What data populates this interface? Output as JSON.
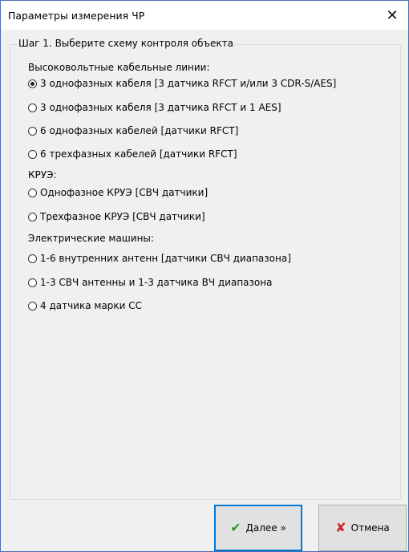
{
  "window": {
    "title": "Параметры измерения ЧР",
    "close_symbol": "✕"
  },
  "group": {
    "legend": "Шаг 1. Выберите схему контроля объекта"
  },
  "sections": {
    "hv_cables": "Высоковольтные кабельные линии:",
    "kru": "КРУЭ:",
    "machines": "Электрические машины:"
  },
  "options": [
    {
      "label": "3 однофазных кабеля [3 датчика RFCT и/или 3 CDR-S/AES]",
      "checked": true
    },
    {
      "label": "3 однофазных кабеля [3 датчика RFCT и 1 AES]",
      "checked": false
    },
    {
      "label": "6 однофазных кабелей [датчики RFCT]",
      "checked": false
    },
    {
      "label": "6 трехфазных кабелей [датчики RFCT]",
      "checked": false
    },
    {
      "label": "Однофазное КРУЭ [СВЧ датчики]",
      "checked": false
    },
    {
      "label": "Трехфазное КРУЭ [СВЧ датчики]",
      "checked": false
    },
    {
      "label": "1-6 внутренних антенн [датчики СВЧ диапазона]",
      "checked": false
    },
    {
      "label": "1-3 СВЧ антенны и 1-3 датчика ВЧ диапазона",
      "checked": false
    },
    {
      "label": "4 датчика марки СС",
      "checked": false
    }
  ],
  "buttons": {
    "next_label": "Далее »",
    "next_icon": "checkmark-icon",
    "cancel_label": "Отмена",
    "cancel_icon": "x-icon"
  },
  "colors": {
    "ok": "#2c9a2c",
    "cancel": "#d42020",
    "focus": "#0078d7"
  }
}
